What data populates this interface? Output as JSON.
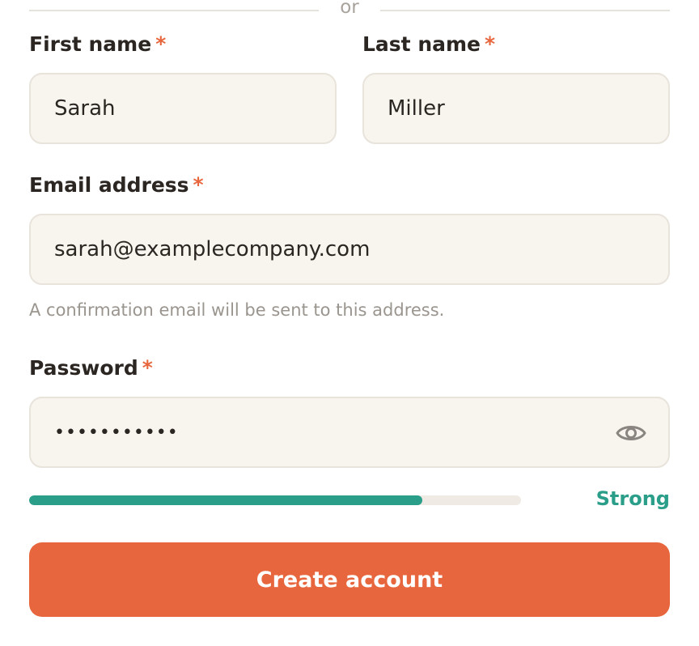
{
  "divider": {
    "text": "or"
  },
  "first_name": {
    "label": "First name",
    "required_mark": "*",
    "value": "Sarah"
  },
  "last_name": {
    "label": "Last name",
    "required_mark": "*",
    "value": "Miller"
  },
  "email": {
    "label": "Email address",
    "required_mark": "*",
    "value": "sarah@examplecompany.com",
    "hint": "A confirmation email will be sent to this address."
  },
  "password": {
    "label": "Password",
    "required_mark": "*",
    "masked_value": "•••••••••••",
    "toggle_icon": "eye-icon"
  },
  "strength": {
    "label": "Strong",
    "fraction": 0.8,
    "color": "#2a9e89"
  },
  "submit": {
    "label": "Create account"
  },
  "colors": {
    "accent": "#e8663d",
    "success": "#2a9e89",
    "field_bg": "#f8f5ef",
    "field_border": "#e8e3db"
  }
}
